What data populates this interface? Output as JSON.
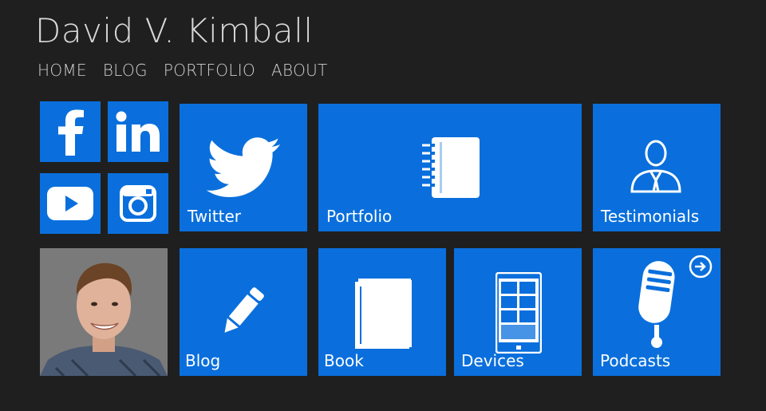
{
  "site": {
    "title": "David V. Kimball"
  },
  "nav": {
    "items": [
      "HOME",
      "BLOG",
      "PORTFOLIO",
      "ABOUT"
    ]
  },
  "social": {
    "facebook": "facebook-icon",
    "linkedin": "linkedin-icon",
    "youtube": "youtube-icon",
    "instagram": "instagram-icon"
  },
  "tiles": {
    "twitter": "Twitter",
    "portfolio": "Portfolio",
    "testimonials": "Testimonials",
    "blog": "Blog",
    "book": "Book",
    "devices": "Devices",
    "podcasts": "Podcasts"
  },
  "colors": {
    "background": "#1f1f1f",
    "tile": "#0a6fdc",
    "text": "#d9d9d9"
  }
}
